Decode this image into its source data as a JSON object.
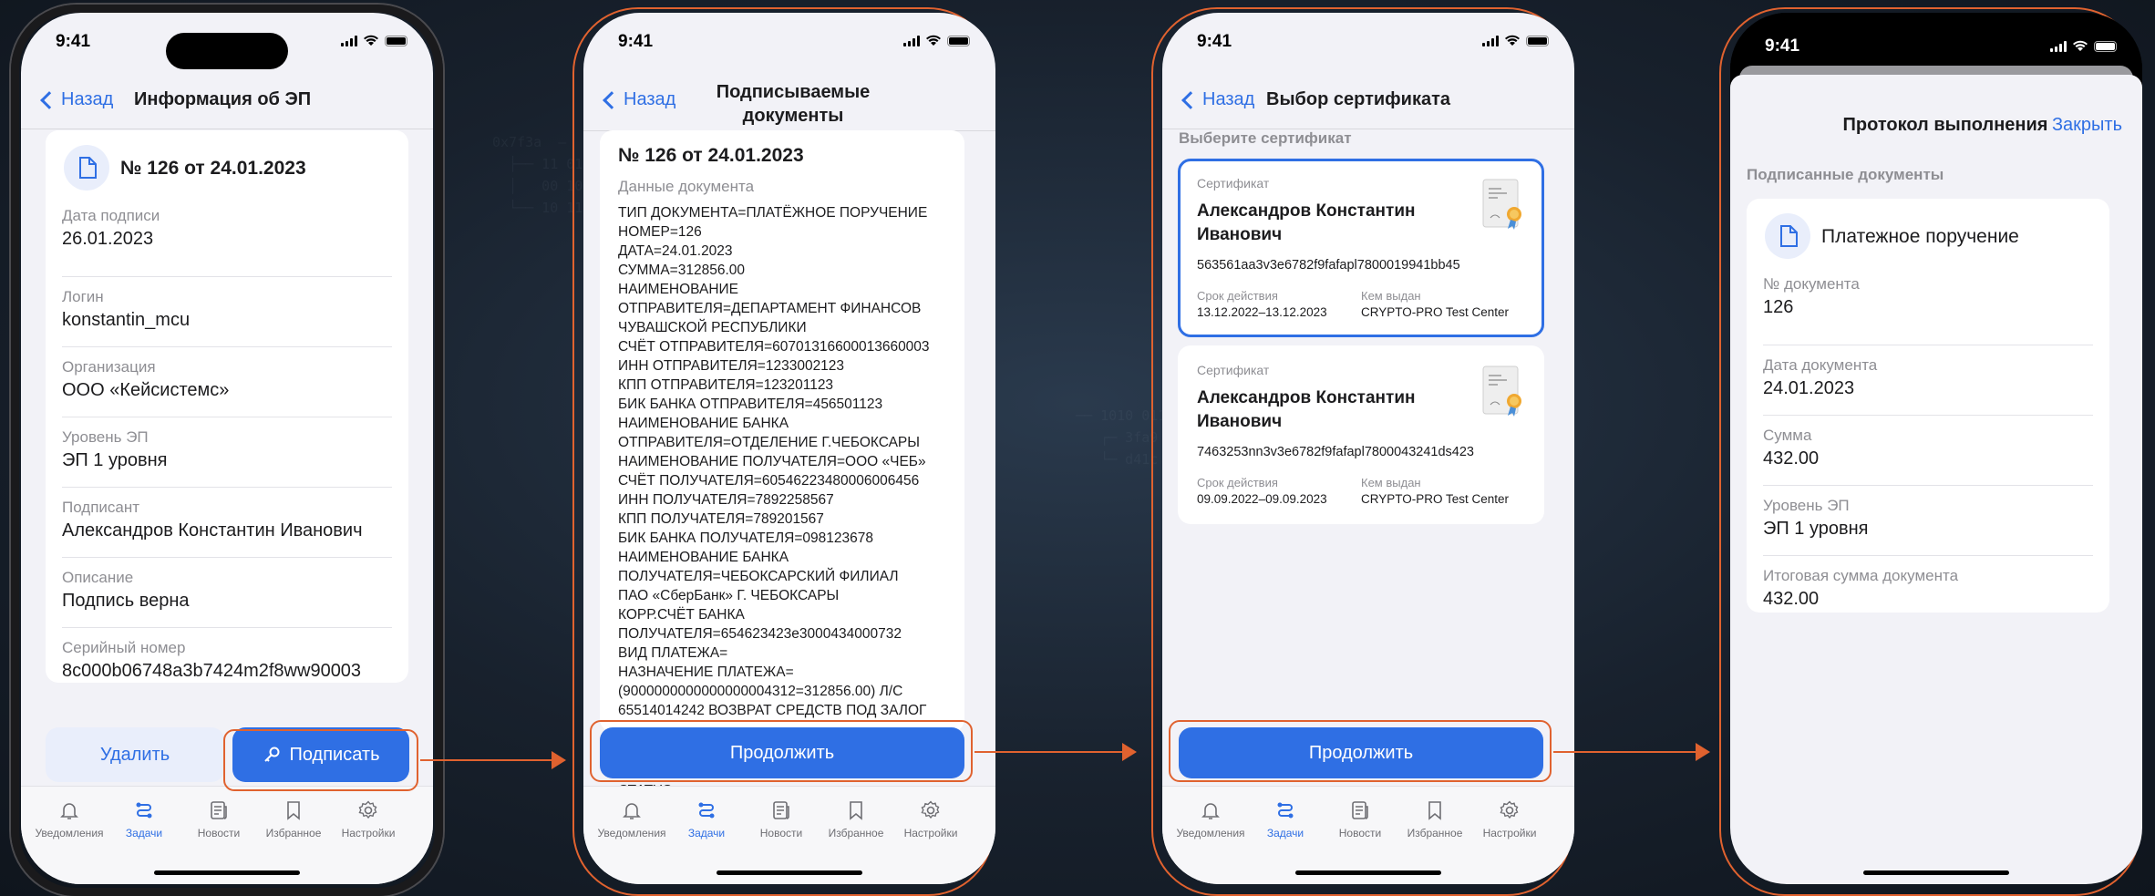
{
  "status_time": "9:41",
  "screen1": {
    "back": "Назад",
    "title": "Информация об ЭП",
    "doc_title": "№ 126 от 24.01.2023",
    "fields": [
      {
        "label": "Дата подписи",
        "value": "26.01.2023"
      },
      {
        "label": "Логин",
        "value": "konstantin_mcu"
      },
      {
        "label": "Организация",
        "value": "ООО «Кейсистемс»"
      },
      {
        "label": "Уровень ЭП",
        "value": "ЭП 1 уровня"
      },
      {
        "label": "Подписант",
        "value": "Александров Константин Иванович"
      },
      {
        "label": "Описание",
        "value": "Подпись верна"
      },
      {
        "label": "Серийный номер",
        "value": "8c000b06748a3b7424m2f8ww90003"
      }
    ],
    "delete_label": "Удалить",
    "sign_label": "Подписать"
  },
  "screen2": {
    "back": "Назад",
    "title_line1": "Подписываемые",
    "title_line2": "документы",
    "doc_title": "№ 126 от 24.01.2023",
    "data_label": "Данные документа",
    "doc_lines": "ТИП ДОКУМЕНТА=ПЛАТЁЖНОЕ ПОРУЧЕНИЕ\nНОМЕР=126\nДАТА=24.01.2023\nСУММА=312856.00\nНАИМЕНОВАНИЕ\nОТПРАВИТЕЛЯ=ДЕПАРТАМЕНТ ФИНАНСОВ\nЧУВАШСКОЙ РЕСПУБЛИКИ\nСЧЁТ ОТПРАВИТЕЛЯ=60701316600013660003\nИНН ОТПРАВИТЕЛЯ=1233002123\nКПП ОТПРАВИТЕЛЯ=123201123\nБИК БАНКА ОТПРАВИТЕЛЯ=456501123\nНАИМЕНОВАНИЕ БАНКА\nОТПРАВИТЕЛЯ=ОТДЕЛЕНИЕ Г.ЧЕБОКСАРЫ\nНАИМЕНОВАНИЕ ПОЛУЧАТЕЛЯ=ООО «ЧЕБ»\nСЧЁТ ПОЛУЧАТЕЛЯ=60546223480006006456\nИНН ПОЛУЧАТЕЛЯ=7892258567\nКПП ПОЛУЧАТЕЛЯ=789201567\nБИК БАНКА ПОЛУЧАТЕЛЯ=098123678\nНАИМЕНОВАНИЕ БАНКА\nПОЛУЧАТЕЛЯ=ЧЕБОКСАРСКИЙ ФИЛИАЛ\nПАО «СберБанк» Г. ЧЕБОКСАРЫ\nКОРР.СЧЁТ БАНКА\nПОЛУЧАТЕЛЯ=654623423e3000434000732\nВИД ПЛАТЕЖА=\nНАЗНАЧЕНИЕ ПЛАТЕЖА=\n(9000000000000000004312=312856.00) Л/С\n65514014242 ВОЗВРАТ СРЕДСТВ ПОД ЗАЛОГ",
    "status_line": "СТАТУС=",
    "continue_label": "Продолжить"
  },
  "screen3": {
    "back": "Назад",
    "title": "Выбор сертификата",
    "section": "Выберите сертификат",
    "certs": [
      {
        "label": "Сертификат",
        "name1": "Александров Константин",
        "name2": "Иванович",
        "id": "563561aa3v3e6782f9fafapl7800019941bb45",
        "valid_label": "Срок действия",
        "valid": "13.12.2022–13.12.2023",
        "issuer_label": "Кем выдан",
        "issuer": "CRYPTO-PRO Test Center"
      },
      {
        "label": "Сертификат",
        "name1": "Александров Константин",
        "name2": "Иванович",
        "id": "7463253nn3v3e6782f9fafapl7800043241ds423",
        "valid_label": "Срок действия",
        "valid": "09.09.2022–09.09.2023",
        "issuer_label": "Кем выдан",
        "issuer": "CRYPTO-PRO Test Center"
      }
    ],
    "continue_label": "Продолжить"
  },
  "screen4": {
    "title": "Протокол выполнения",
    "close": "Закрыть",
    "section": "Подписанные документы",
    "doc_title": "Платежное поручение",
    "fields": [
      {
        "label": "№ документа",
        "value": "126"
      },
      {
        "label": "Дата документа",
        "value": "24.01.2023"
      },
      {
        "label": "Сумма",
        "value": "432.00"
      },
      {
        "label": "Уровень ЭП",
        "value": "ЭП 1 уровня"
      },
      {
        "label": "Итоговая сумма документа",
        "value": "432.00"
      }
    ]
  },
  "tabs": [
    {
      "label": "Уведомления",
      "icon": "bell-icon"
    },
    {
      "label": "Задачи",
      "icon": "tasks-icon"
    },
    {
      "label": "Новости",
      "icon": "news-icon"
    },
    {
      "label": "Избранное",
      "icon": "bookmark-icon"
    },
    {
      "label": "Настройки",
      "icon": "gear-icon"
    }
  ],
  "colors": {
    "accent": "#2f6fe4",
    "highlight": "#e0622f",
    "background": "#18212d"
  }
}
